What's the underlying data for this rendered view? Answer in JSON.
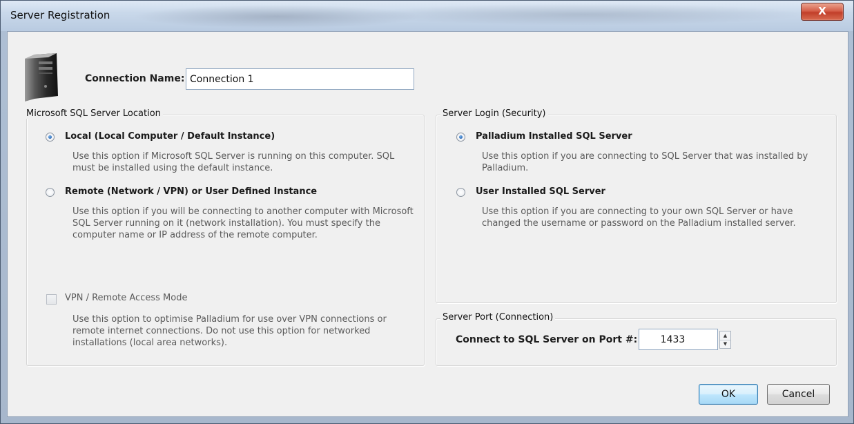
{
  "window": {
    "title": "Server Registration",
    "close_label": "X"
  },
  "connection": {
    "label": "Connection Name:",
    "value": "Connection 1"
  },
  "location_group": {
    "legend": "Microsoft SQL Server Location",
    "options": [
      {
        "label": "Local (Local Computer / Default Instance)",
        "description": "Use this option if Microsoft SQL Server is running on this computer. SQL must be installed using the default instance.",
        "checked": true
      },
      {
        "label": "Remote (Network / VPN) or User Defined Instance",
        "description": "Use this option if you will be connecting to another computer with Microsoft SQL Server running on it (network installation). You must specify the computer name or IP address of the remote computer.",
        "checked": false
      }
    ],
    "vpn": {
      "label": "VPN / Remote Access Mode",
      "description": "Use this option to optimise Palladium for use over VPN connections or remote internet connections. Do not use this option for networked installations (local area networks).",
      "checked": false
    }
  },
  "login_group": {
    "legend": "Server Login (Security)",
    "options": [
      {
        "label": "Palladium Installed SQL Server",
        "description": "Use this option if you are connecting to SQL Server that was installed by Palladium.",
        "checked": true
      },
      {
        "label": "User Installed SQL Server",
        "description": "Use this option if you are connecting to your own SQL Server or have changed the username or password on the Palladium installed server.",
        "checked": false
      }
    ]
  },
  "port_group": {
    "legend": "Server Port (Connection)",
    "label": "Connect to SQL Server on Port #:",
    "value": "1433"
  },
  "buttons": {
    "ok": "OK",
    "cancel": "Cancel"
  },
  "icons": {
    "server": "server-tower-icon",
    "spin_up": "up-arrow-icon",
    "spin_down": "down-arrow-icon"
  },
  "colors": {
    "default_button_border": "#3c7fb1",
    "close_button": "#c13f2a"
  }
}
